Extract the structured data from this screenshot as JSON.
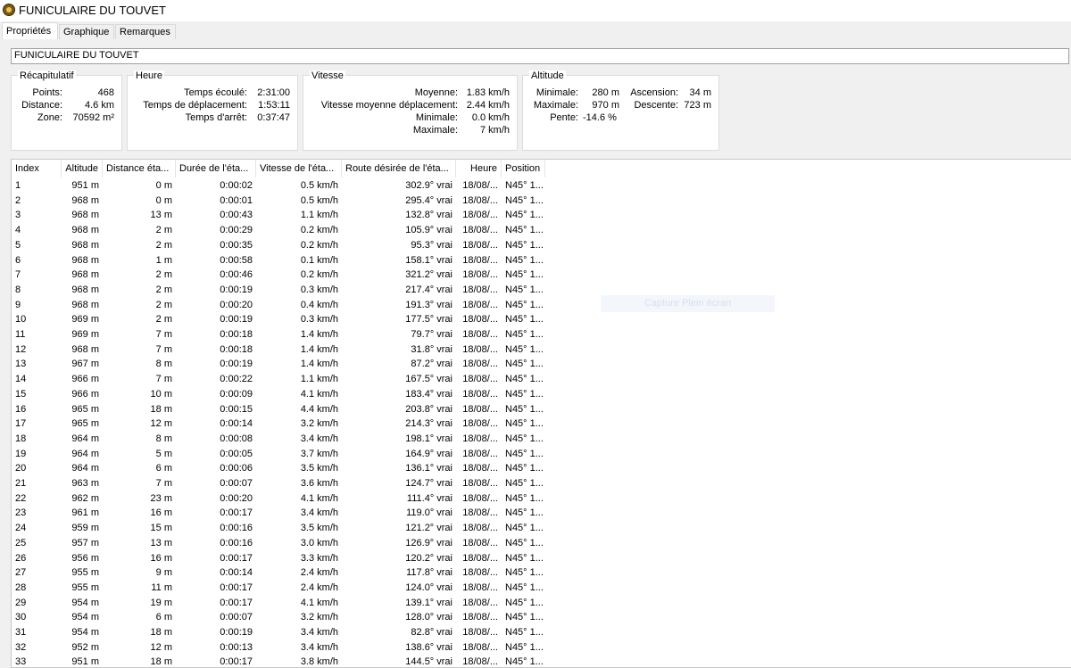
{
  "window": {
    "title": "FUNICULAIRE DU TOUVET",
    "icon": "app-globe-icon"
  },
  "tabs": [
    {
      "label": "Propriétés",
      "active": true
    },
    {
      "label": "Graphique",
      "active": false
    },
    {
      "label": "Remarques",
      "active": false
    }
  ],
  "track_name": "FUNICULAIRE DU TOUVET",
  "summary": {
    "title": "Récapitulatif",
    "points_label": "Points:",
    "points": "468",
    "distance_label": "Distance:",
    "distance": "4.6 km",
    "zone_label": "Zone:",
    "zone": "70592 m²"
  },
  "time": {
    "title": "Heure",
    "elapsed_label": "Temps écoulé:",
    "elapsed": "2:31:00",
    "moving_label": "Temps de déplacement:",
    "moving": "1:53:11",
    "stopped_label": "Temps d'arrêt:",
    "stopped": "0:37:47"
  },
  "speed": {
    "title": "Vitesse",
    "avg_label": "Moyenne:",
    "avg": "1.83 km/h",
    "moving_avg_label": "Vitesse moyenne déplacement:",
    "moving_avg": "2.44 km/h",
    "min_label": "Minimale:",
    "min": "0.0 km/h",
    "max_label": "Maximale:",
    "max": "7 km/h"
  },
  "altitude": {
    "title": "Altitude",
    "min_label": "Minimale:",
    "min": "280 m",
    "max_label": "Maximale:",
    "max": "970 m",
    "ascent_label": "Ascension:",
    "ascent": "34 m",
    "descent_label": "Descente:",
    "descent": "723 m",
    "slope_label": "Pente:",
    "slope": "-14.6 %"
  },
  "overlay_text": "Capture Plein écran",
  "table": {
    "columns": [
      "Index",
      "Altitude",
      "Distance éta...",
      "Durée de l'éta...",
      "Vitesse de l'éta...",
      "Route désirée de l'éta...",
      "Heure",
      "Position"
    ],
    "rows": [
      [
        "1",
        "951 m",
        "0 m",
        "0:00:02",
        "0.5 km/h",
        "302.9° vrai",
        "18/08/...",
        "N45° 1..."
      ],
      [
        "2",
        "968 m",
        "0 m",
        "0:00:01",
        "0.5 km/h",
        "295.4° vrai",
        "18/08/...",
        "N45° 1..."
      ],
      [
        "3",
        "968 m",
        "13 m",
        "0:00:43",
        "1.1 km/h",
        "132.8° vrai",
        "18/08/...",
        "N45° 1..."
      ],
      [
        "4",
        "968 m",
        "2 m",
        "0:00:29",
        "0.2 km/h",
        "105.9° vrai",
        "18/08/...",
        "N45° 1..."
      ],
      [
        "5",
        "968 m",
        "2 m",
        "0:00:35",
        "0.2 km/h",
        "95.3° vrai",
        "18/08/...",
        "N45° 1..."
      ],
      [
        "6",
        "968 m",
        "1 m",
        "0:00:58",
        "0.1 km/h",
        "158.1° vrai",
        "18/08/...",
        "N45° 1..."
      ],
      [
        "7",
        "968 m",
        "2 m",
        "0:00:46",
        "0.2 km/h",
        "321.2° vrai",
        "18/08/...",
        "N45° 1..."
      ],
      [
        "8",
        "968 m",
        "2 m",
        "0:00:19",
        "0.3 km/h",
        "217.4° vrai",
        "18/08/...",
        "N45° 1..."
      ],
      [
        "9",
        "968 m",
        "2 m",
        "0:00:20",
        "0.4 km/h",
        "191.3° vrai",
        "18/08/...",
        "N45° 1..."
      ],
      [
        "10",
        "969 m",
        "2 m",
        "0:00:19",
        "0.3 km/h",
        "177.5° vrai",
        "18/08/...",
        "N45° 1..."
      ],
      [
        "11",
        "969 m",
        "7 m",
        "0:00:18",
        "1.4 km/h",
        "79.7° vrai",
        "18/08/...",
        "N45° 1..."
      ],
      [
        "12",
        "968 m",
        "7 m",
        "0:00:18",
        "1.4 km/h",
        "31.8° vrai",
        "18/08/...",
        "N45° 1..."
      ],
      [
        "13",
        "967 m",
        "8 m",
        "0:00:19",
        "1.4 km/h",
        "87.2° vrai",
        "18/08/...",
        "N45° 1..."
      ],
      [
        "14",
        "966 m",
        "7 m",
        "0:00:22",
        "1.1 km/h",
        "167.5° vrai",
        "18/08/...",
        "N45° 1..."
      ],
      [
        "15",
        "966 m",
        "10 m",
        "0:00:09",
        "4.1 km/h",
        "183.4° vrai",
        "18/08/...",
        "N45° 1..."
      ],
      [
        "16",
        "965 m",
        "18 m",
        "0:00:15",
        "4.4 km/h",
        "203.8° vrai",
        "18/08/...",
        "N45° 1..."
      ],
      [
        "17",
        "965 m",
        "12 m",
        "0:00:14",
        "3.2 km/h",
        "214.3° vrai",
        "18/08/...",
        "N45° 1..."
      ],
      [
        "18",
        "964 m",
        "8 m",
        "0:00:08",
        "3.4 km/h",
        "198.1° vrai",
        "18/08/...",
        "N45° 1..."
      ],
      [
        "19",
        "964 m",
        "5 m",
        "0:00:05",
        "3.7 km/h",
        "164.9° vrai",
        "18/08/...",
        "N45° 1..."
      ],
      [
        "20",
        "964 m",
        "6 m",
        "0:00:06",
        "3.5 km/h",
        "136.1° vrai",
        "18/08/...",
        "N45° 1..."
      ],
      [
        "21",
        "963 m",
        "7 m",
        "0:00:07",
        "3.6 km/h",
        "124.7° vrai",
        "18/08/...",
        "N45° 1..."
      ],
      [
        "22",
        "962 m",
        "23 m",
        "0:00:20",
        "4.1 km/h",
        "111.4° vrai",
        "18/08/...",
        "N45° 1..."
      ],
      [
        "23",
        "961 m",
        "16 m",
        "0:00:17",
        "3.4 km/h",
        "119.0° vrai",
        "18/08/...",
        "N45° 1..."
      ],
      [
        "24",
        "959 m",
        "15 m",
        "0:00:16",
        "3.5 km/h",
        "121.2° vrai",
        "18/08/...",
        "N45° 1..."
      ],
      [
        "25",
        "957 m",
        "13 m",
        "0:00:16",
        "3.0 km/h",
        "126.9° vrai",
        "18/08/...",
        "N45° 1..."
      ],
      [
        "26",
        "956 m",
        "16 m",
        "0:00:17",
        "3.3 km/h",
        "120.2° vrai",
        "18/08/...",
        "N45° 1..."
      ],
      [
        "27",
        "955 m",
        "9 m",
        "0:00:14",
        "2.4 km/h",
        "117.8° vrai",
        "18/08/...",
        "N45° 1..."
      ],
      [
        "28",
        "955 m",
        "11 m",
        "0:00:17",
        "2.4 km/h",
        "124.0° vrai",
        "18/08/...",
        "N45° 1..."
      ],
      [
        "29",
        "954 m",
        "19 m",
        "0:00:17",
        "4.1 km/h",
        "139.1° vrai",
        "18/08/...",
        "N45° 1..."
      ],
      [
        "30",
        "954 m",
        "6 m",
        "0:00:07",
        "3.2 km/h",
        "128.0° vrai",
        "18/08/...",
        "N45° 1..."
      ],
      [
        "31",
        "954 m",
        "18 m",
        "0:00:19",
        "3.4 km/h",
        "82.8° vrai",
        "18/08/...",
        "N45° 1..."
      ],
      [
        "32",
        "952 m",
        "12 m",
        "0:00:13",
        "3.4 km/h",
        "138.6° vrai",
        "18/08/...",
        "N45° 1..."
      ],
      [
        "33",
        "951 m",
        "18 m",
        "0:00:17",
        "3.8 km/h",
        "144.5° vrai",
        "18/08/...",
        "N45° 1..."
      ]
    ]
  }
}
